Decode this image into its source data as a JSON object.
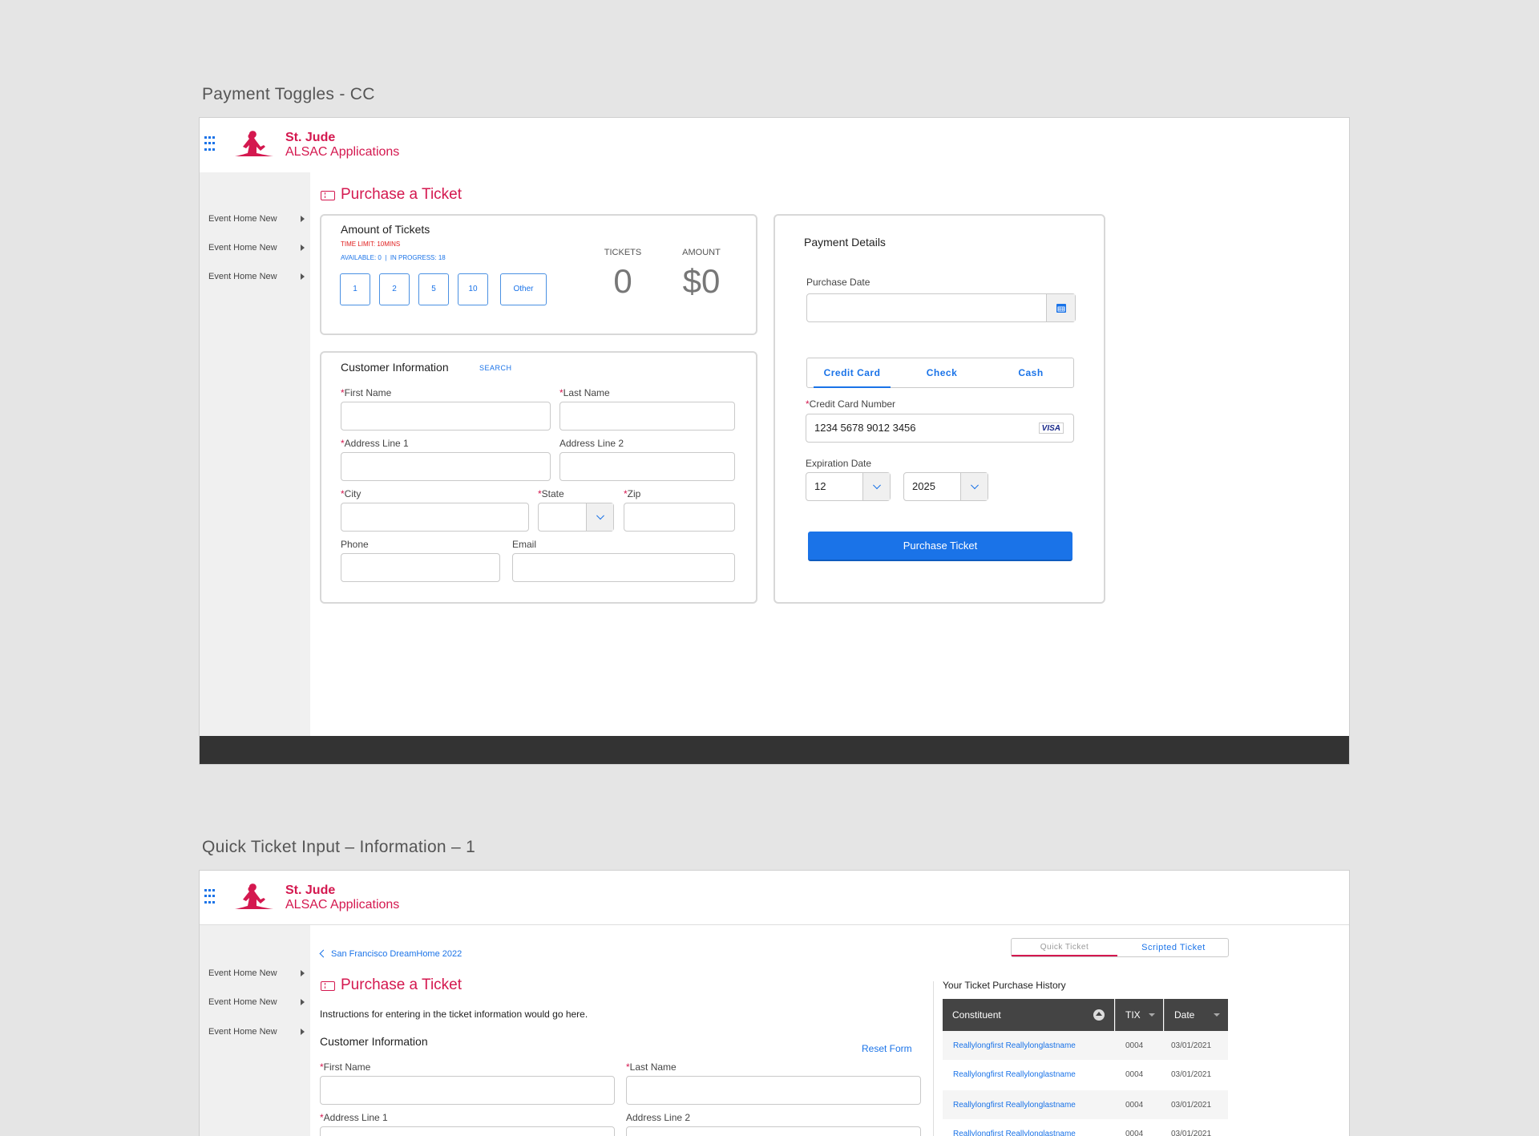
{
  "brand": {
    "line1": "St. Jude",
    "line2": "ALSAC Applications"
  },
  "section1": {
    "title": "Payment Toggles - CC",
    "sidebar": [
      "Event Home New",
      "Event Home New",
      "Event Home New"
    ],
    "page_title": "Purchase a Ticket",
    "amount_card": {
      "title": "Amount of Tickets",
      "time_limit": "TIME LIMIT: 10MINS",
      "availability": "AVAILABLE: 0  |  IN PROGRESS: 18",
      "quantities": [
        "1",
        "2",
        "5",
        "10",
        "Other"
      ],
      "tickets_label": "TICKETS",
      "tickets_value": "0",
      "amount_label": "AMOUNT",
      "amount_value": "$0"
    },
    "customer_card": {
      "title": "Customer Information",
      "search_link": "SEARCH",
      "first_name_label": "First Name",
      "last_name_label": "Last Name",
      "address1_label": "Address Line 1",
      "address2_label": "Address Line 2",
      "city_label": "City",
      "state_label": "State",
      "zip_label": "Zip",
      "phone_label": "Phone",
      "email_label": "Email"
    },
    "payment_card": {
      "title": "Payment Details",
      "purchase_date_label": "Purchase Date",
      "tabs": [
        "Credit Card",
        "Check",
        "Cash"
      ],
      "active_tab": "Credit Card",
      "cc_number_label": "Credit Card Number",
      "cc_number_value": "1234 5678 9012 3456",
      "card_brand": "VISA",
      "expiration_label": "Expiration Date",
      "exp_month": "12",
      "exp_year": "2025",
      "purchase_button": "Purchase Ticket"
    }
  },
  "section2": {
    "title": "Quick Ticket Input – Information – 1",
    "sidebar": [
      "Event Home New",
      "Event Home New",
      "Event Home New"
    ],
    "breadcrumb": "San Francisco DreamHome 2022",
    "page_title": "Purchase a Ticket",
    "instructions": "Instructions for entering in the ticket information would go here.",
    "customer_title": "Customer Information",
    "reset_link": "Reset Form",
    "first_name_label": "First Name",
    "last_name_label": "Last Name",
    "address1_label": "Address Line 1",
    "address2_label": "Address Line 2",
    "toggle": [
      "Quick Ticket",
      "Scripted Ticket"
    ],
    "history": {
      "title": "Your Ticket Purchase History",
      "columns": [
        "Constituent",
        "TIX",
        "Date"
      ],
      "rows": [
        {
          "name": "Reallylongfirst Reallylonglastname",
          "tix": "0004",
          "date": "03/01/2021"
        },
        {
          "name": "Reallylongfirst Reallylonglastname",
          "tix": "0004",
          "date": "03/01/2021"
        },
        {
          "name": "Reallylongfirst Reallylonglastname",
          "tix": "0004",
          "date": "03/01/2021"
        },
        {
          "name": "Reallylongfirst Reallylonglastname",
          "tix": "0004",
          "date": "03/01/2021"
        }
      ]
    }
  },
  "colors": {
    "brand_red": "#d4184f",
    "accent_blue": "#1a73e8",
    "dark_bar": "#333333"
  }
}
